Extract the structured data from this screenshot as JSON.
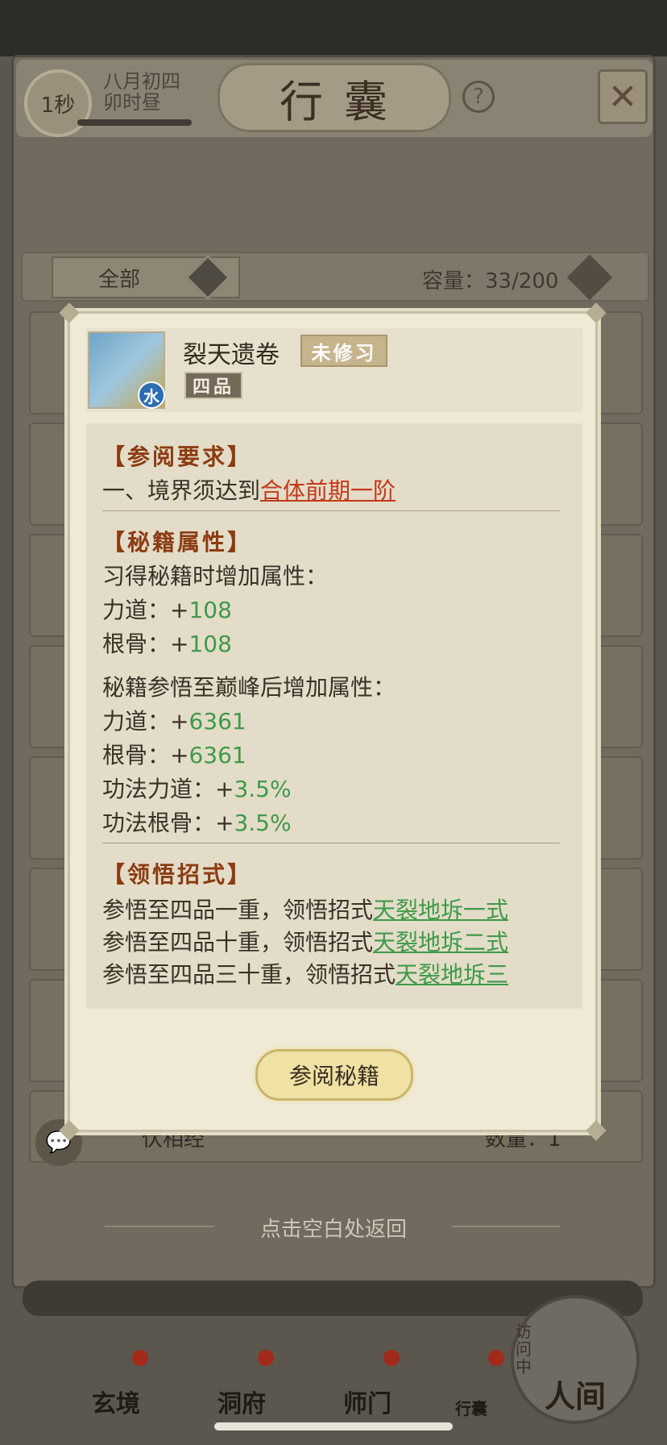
{
  "header": {
    "timer": "1秒",
    "date_line1": "八月初四",
    "date_line2": "卯时昼",
    "title": "行囊",
    "help_glyph": "?",
    "close_glyph": "✕"
  },
  "filter": {
    "selected": "全部",
    "capacity": "容量：33/200"
  },
  "background_row": {
    "name": "伏相经",
    "quantity": "数量：1"
  },
  "modal": {
    "item_name": "裂天遗卷",
    "status": "未修习",
    "grade": "四品",
    "element": "水",
    "sections": {
      "requirement": {
        "title": "【参阅要求】",
        "line_prefix": "一、境界须达到",
        "line_link": "合体前期一阶"
      },
      "attributes": {
        "title": "【秘籍属性】",
        "learn_heading": "习得秘籍时增加属性：",
        "learn": [
          {
            "label": "力道：+",
            "value": "108"
          },
          {
            "label": "根骨：+",
            "value": "108"
          }
        ],
        "peak_heading": "秘籍参悟至巅峰后增加属性：",
        "peak": [
          {
            "label": "力道：+",
            "value": "6361"
          },
          {
            "label": "根骨：+",
            "value": "6361"
          },
          {
            "label": "功法力道：+",
            "value": "3.5%"
          },
          {
            "label": "功法根骨：+",
            "value": "3.5%"
          }
        ]
      },
      "moves": {
        "title": "【领悟招式】",
        "lines": [
          {
            "prefix": "参悟至四品一重，领悟招式",
            "link": "天裂地坼一式"
          },
          {
            "prefix": "参悟至四品十重，领悟招式",
            "link": "天裂地坼二式"
          },
          {
            "prefix": "参悟至四品三十重，领悟招式",
            "link": "天裂地坼三"
          }
        ]
      }
    },
    "read_button": "参阅秘籍"
  },
  "return_hint": "点击空白处返回",
  "bottom_nav": [
    {
      "label": "玄境"
    },
    {
      "label": "洞府"
    },
    {
      "label": "师门"
    },
    {
      "label": "行囊"
    },
    {
      "label": "人间"
    }
  ],
  "world_badge": "访问中",
  "colors": {
    "section_title": "#8c3c12",
    "requirement_link": "#c4391b",
    "value_green": "#3e9a48"
  }
}
